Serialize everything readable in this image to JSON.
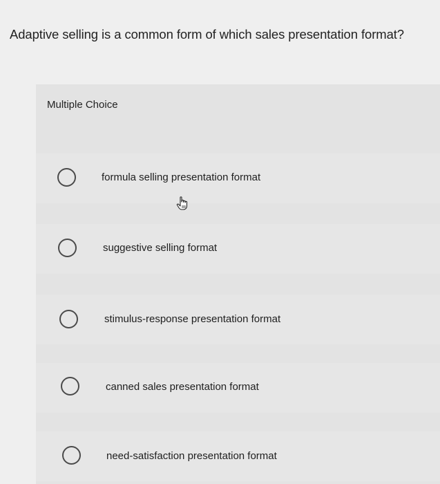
{
  "question": "Adaptive selling is a common form of which sales presentation format?",
  "question_type": "Multiple Choice",
  "options": [
    {
      "label": "formula selling presentation format"
    },
    {
      "label": "suggestive selling format"
    },
    {
      "label": "stimulus-response presentation format"
    },
    {
      "label": "canned sales presentation format"
    },
    {
      "label": "need-satisfaction presentation format"
    }
  ],
  "cursor_icon": "hand-pointer-icon"
}
